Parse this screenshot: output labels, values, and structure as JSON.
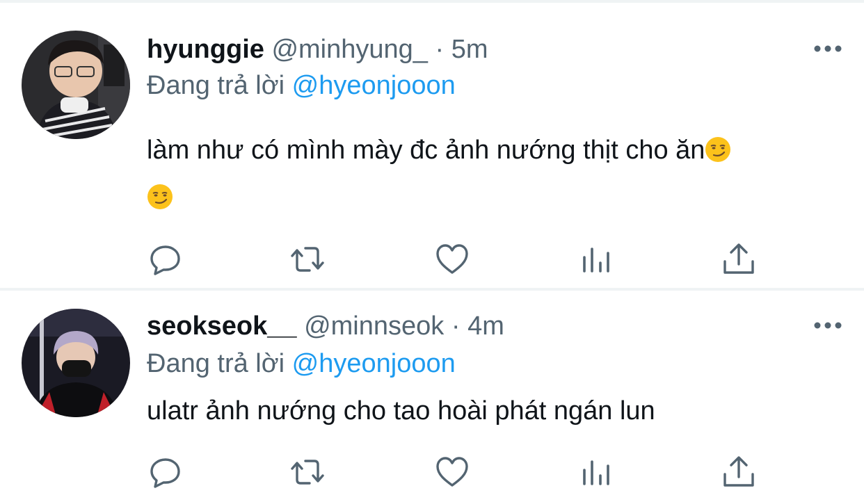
{
  "tweets": [
    {
      "display_name": "hyunggie",
      "handle": "@minhyung_",
      "separator": "·",
      "time": "5m",
      "reply_prefix": "Đang trả lời",
      "reply_to": "@hyeonjooon",
      "text": "làm như có mình mày đc ảnh nướng thịt cho ăn",
      "emoji": [
        "smirking-face-emoji",
        "smirking-face-emoji"
      ],
      "actions": [
        "reply-icon",
        "retweet-icon",
        "like-icon",
        "analytics-icon",
        "share-icon"
      ]
    },
    {
      "display_name": "seokseok__",
      "handle": "@minnseok",
      "separator": "·",
      "time": "4m",
      "reply_prefix": "Đang trả lời",
      "reply_to": "@hyeonjooon",
      "text": "ulatr ảnh nướng cho tao hoài phát ngán lun",
      "actions": [
        "reply-icon",
        "retweet-icon",
        "like-icon",
        "analytics-icon",
        "share-icon"
      ]
    }
  ],
  "colors": {
    "text": "#0f1419",
    "secondary": "#536471",
    "link": "#1d9bf0",
    "divider": "#eff3f4"
  }
}
